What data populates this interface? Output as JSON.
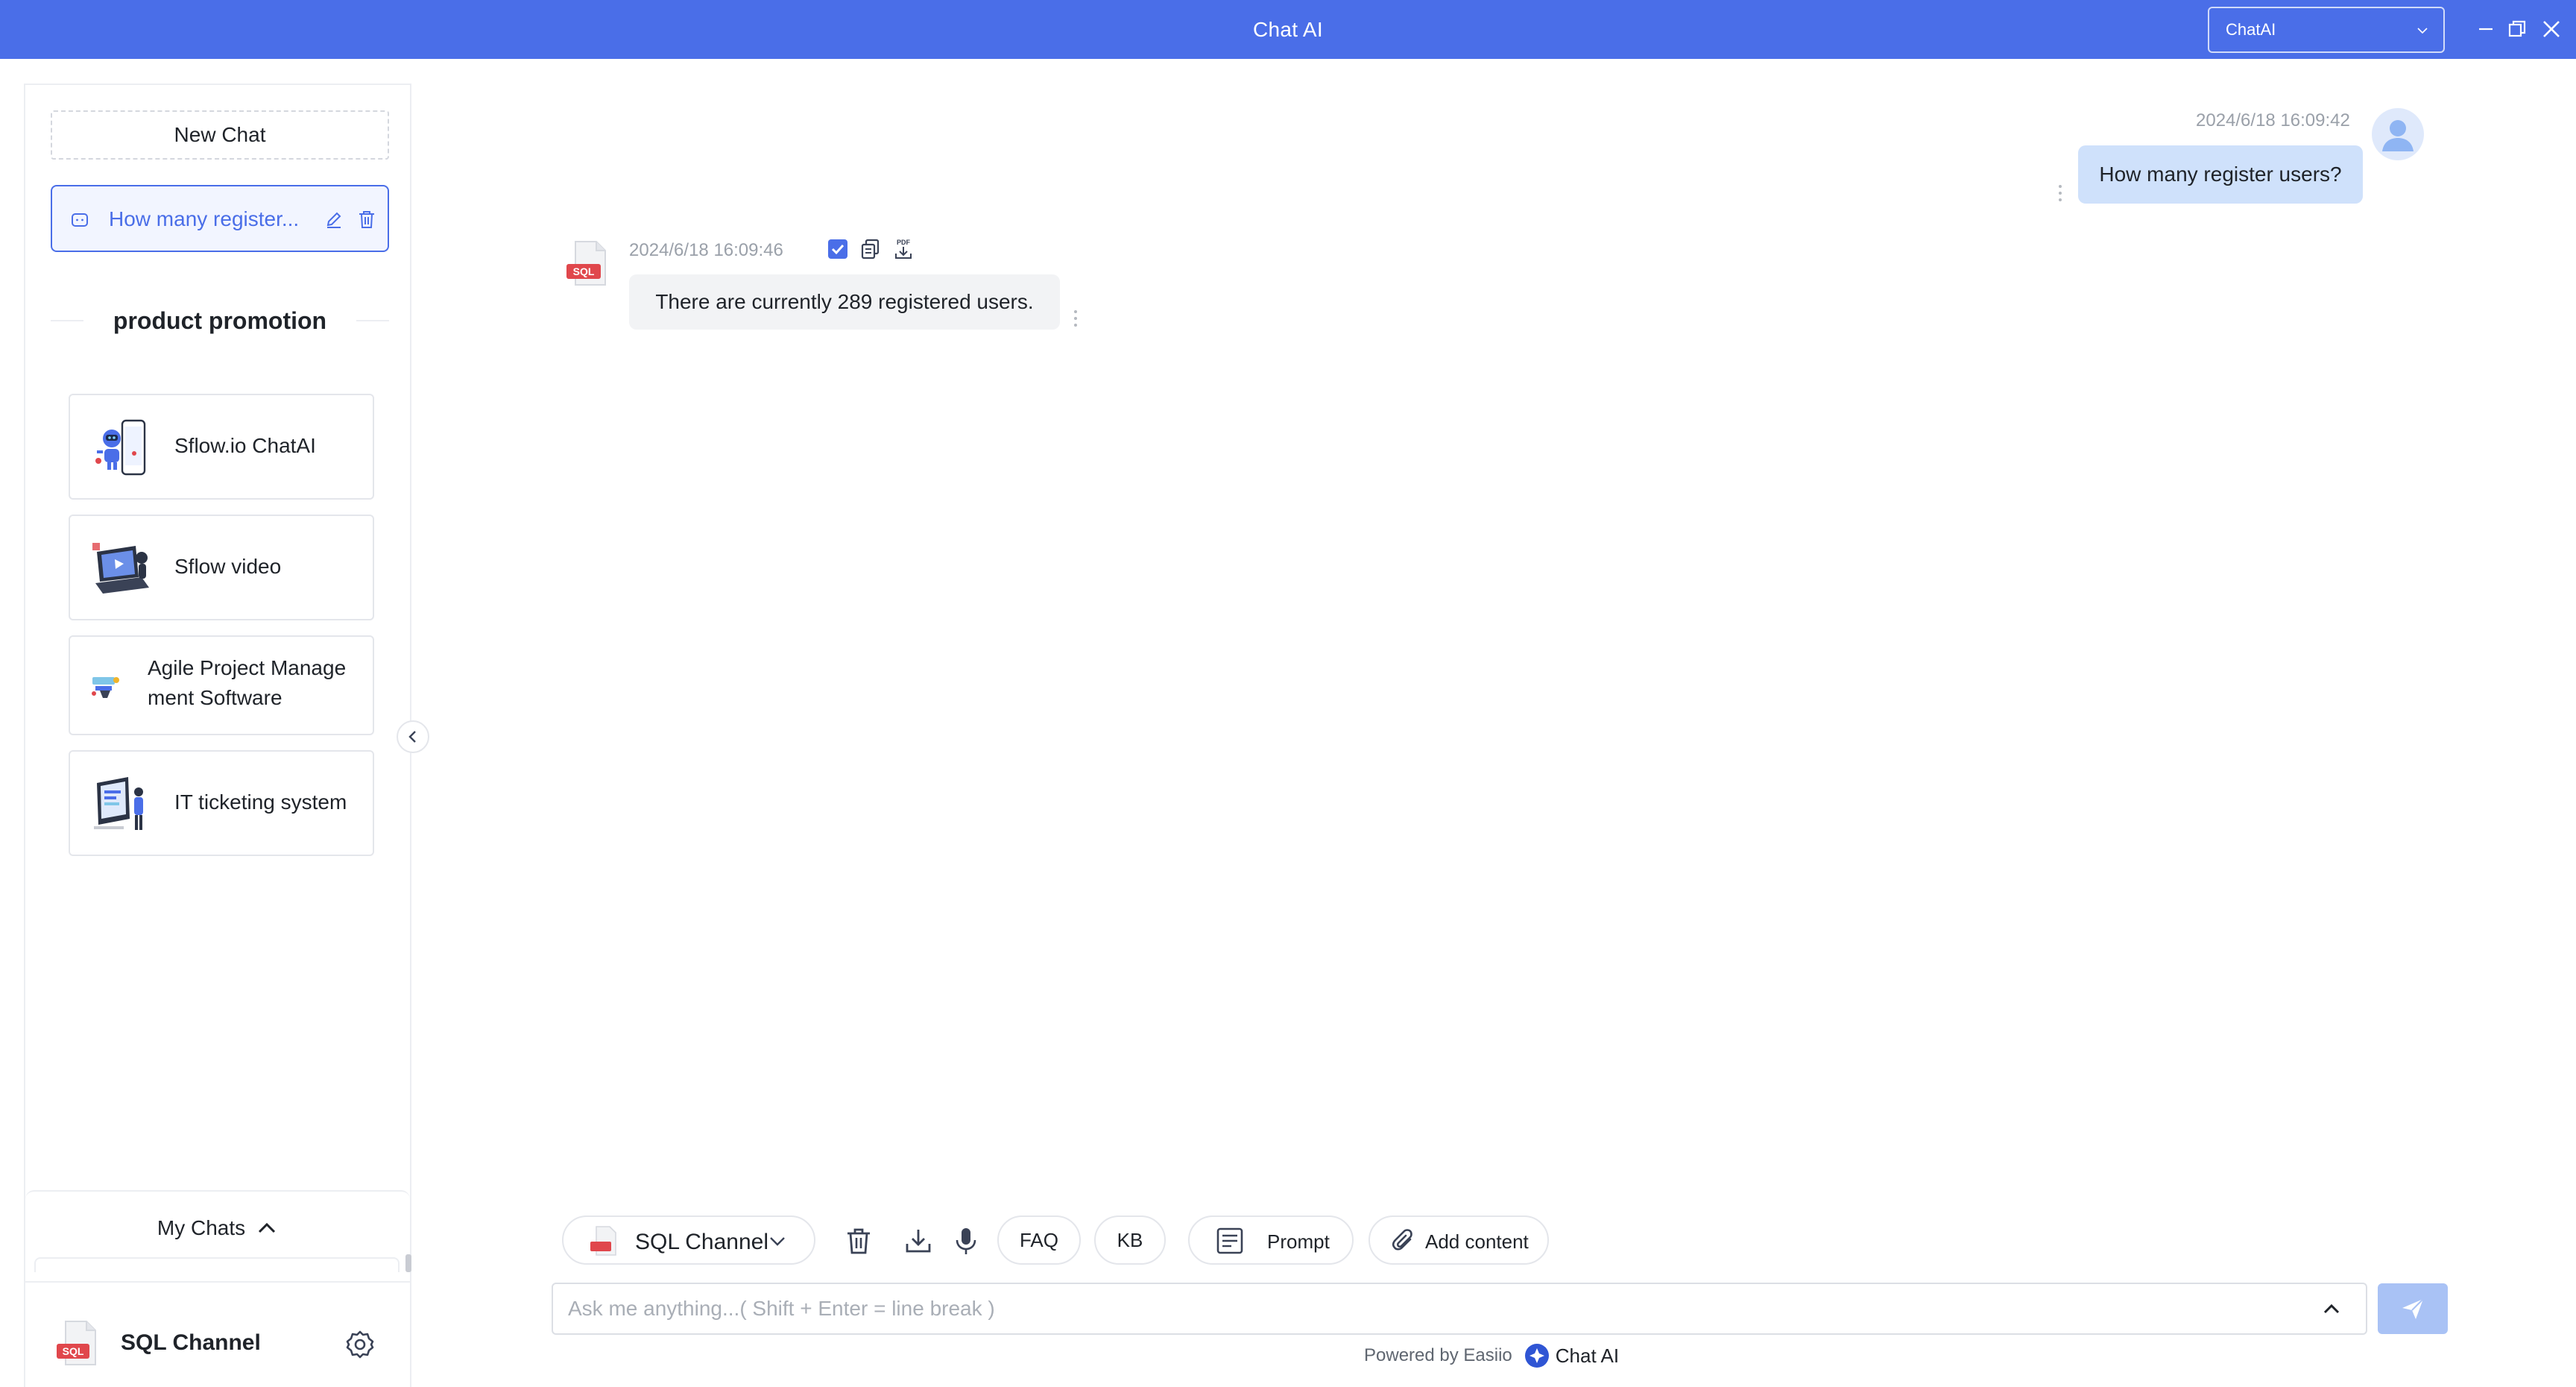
{
  "window": {
    "title": "Chat AI",
    "app_selector": "ChatAI"
  },
  "sidebar": {
    "new_chat_label": "New Chat",
    "active_chat": {
      "label": "How many register..."
    },
    "promotion_heading": "product promotion",
    "promotions": [
      {
        "label": "Sflow.io ChatAI",
        "icon": "robot-phone-illustration"
      },
      {
        "label": "Sflow video",
        "icon": "laptop-video-illustration"
      },
      {
        "label_line1": "Agile Project Manage",
        "label_line2": "ment Software",
        "icon": "project-illustration"
      },
      {
        "label": "IT ticketing system",
        "icon": "ticketing-illustration"
      }
    ],
    "my_chats_label": "My Chats",
    "channel": {
      "name": "SQL Channel",
      "logo_text": "SQL"
    }
  },
  "conversation": {
    "user_message": {
      "timestamp": "2024/6/18 16:09:42",
      "text": "How many register users?"
    },
    "bot_message": {
      "timestamp": "2024/6/18 16:09:46",
      "text": "There are currently 289 registered users.",
      "avatar_text": "SQL",
      "pdf_label": "PDF"
    }
  },
  "composer": {
    "channel_select": "SQL Channel",
    "faq_label": "FAQ",
    "kb_label": "KB",
    "prompt_label": "Prompt",
    "add_content_label": "Add content",
    "placeholder": "Ask me anything...( Shift + Enter = line break )",
    "powered_by": "Powered by Easiio",
    "brand": "Chat AI"
  },
  "colors": {
    "accent": "#4a6ee8",
    "user_bubble": "#cfe1fb",
    "bot_bubble": "#f2f3f5",
    "send_disabled": "#a9c2f5",
    "sql_red": "#e0474c"
  }
}
